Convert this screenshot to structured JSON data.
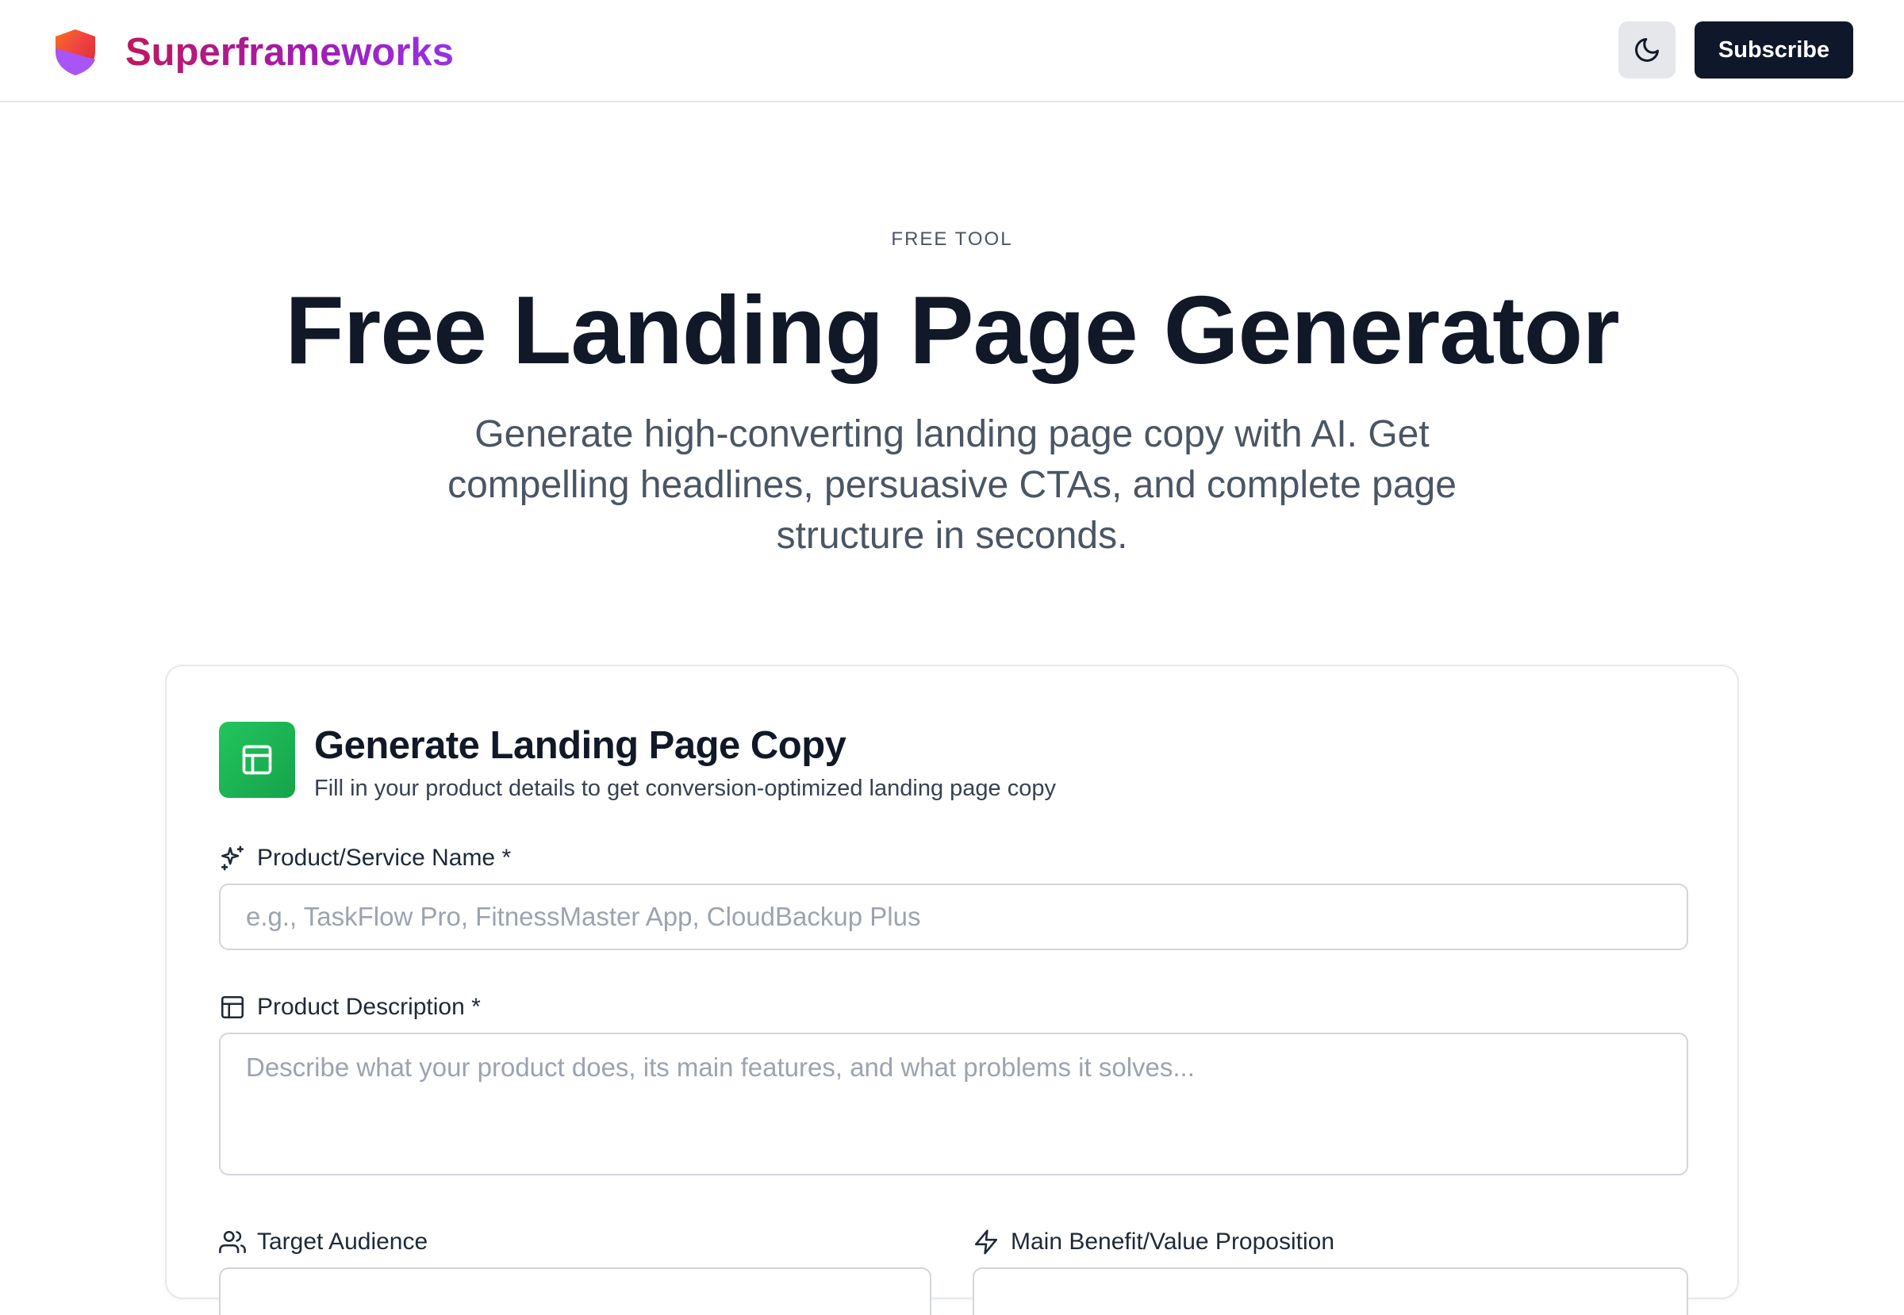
{
  "header": {
    "brand_name": "Superframeworks",
    "theme_toggle_icon": "moon-icon",
    "subscribe_label": "Subscribe",
    "brand_gradient": [
      "#be185d",
      "#9333ea"
    ],
    "logo_colors": [
      "#ef4444",
      "#a855f7"
    ]
  },
  "hero": {
    "eyebrow": "FREE TOOL",
    "title": "Free Landing Page Generator",
    "subtitle": "Generate high-converting landing page copy with AI. Get compelling headlines, persuasive CTAs, and complete page structure in seconds."
  },
  "card": {
    "icon": "layout-icon",
    "icon_color": "#22c55e",
    "title": "Generate Landing Page Copy",
    "description": "Fill in your product details to get conversion-optimized landing page copy",
    "fields": {
      "product_name": {
        "icon": "sparkles-icon",
        "label": "Product/Service Name *",
        "value": "",
        "placeholder": "e.g., TaskFlow Pro, FitnessMaster App, CloudBackup Plus"
      },
      "product_description": {
        "icon": "layout-icon",
        "label": "Product Description *",
        "value": "",
        "placeholder": "Describe what your product does, its main features, and what problems it solves..."
      },
      "target_audience": {
        "icon": "users-icon",
        "label": "Target Audience"
      },
      "main_benefit": {
        "icon": "zap-icon",
        "label": "Main Benefit/Value Proposition"
      }
    }
  }
}
